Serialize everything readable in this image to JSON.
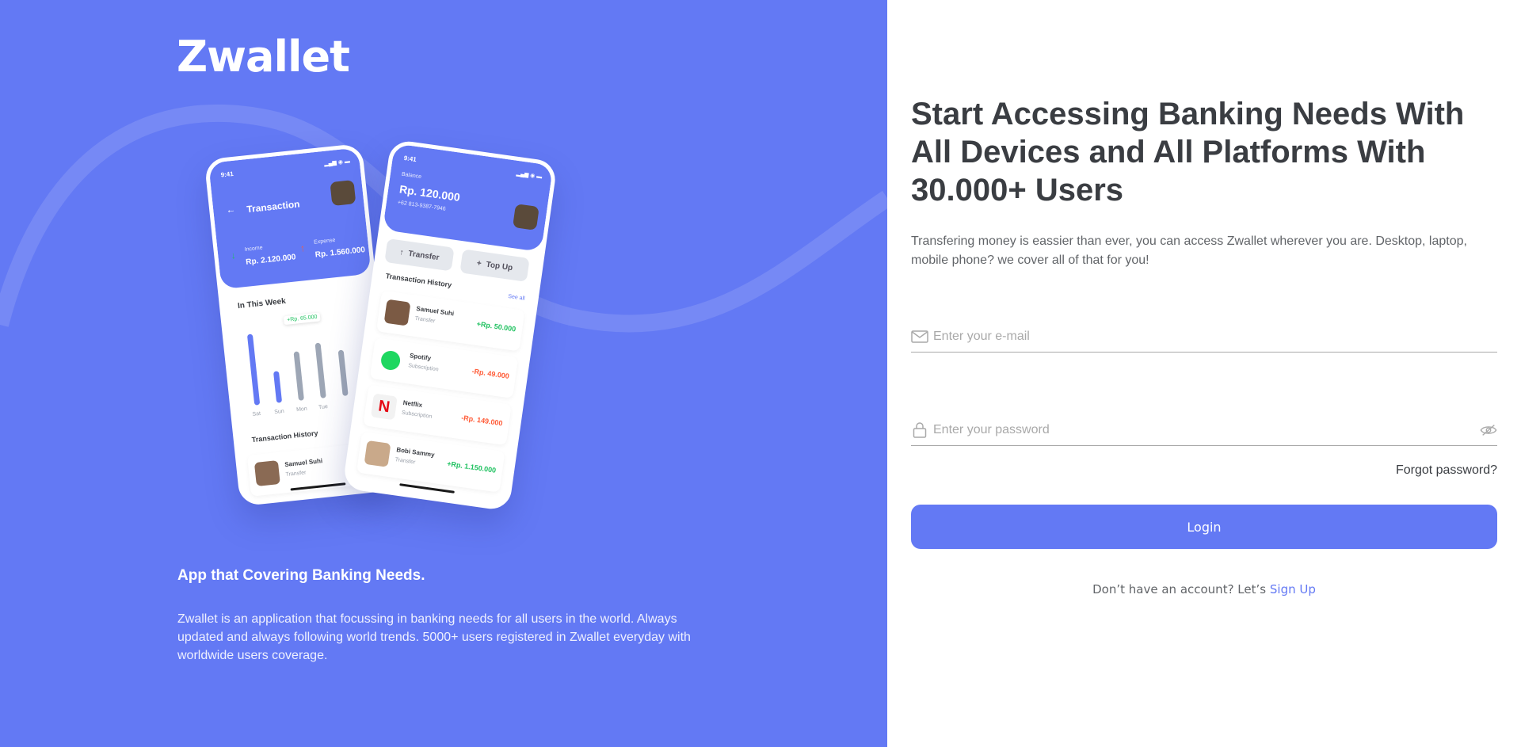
{
  "brand": {
    "logo": "Zwallet",
    "color": "#6379F4"
  },
  "hero": {
    "tagline": "App that Covering Banking Needs.",
    "description": "Zwallet is an application that focussing in banking needs for all users in the world. Always updated and always following world trends. 5000+ users registered in Zwallet everyday with worldwide users coverage."
  },
  "phone_left": {
    "time": "9:41",
    "title": "Transaction",
    "income_label": "Income",
    "income_amount": "Rp. 2.120.000",
    "expense_label": "Expense",
    "expense_amount": "Rp. 1.560.000",
    "week_label": "In This Week",
    "tooltip": "+Rp. 65.000",
    "days": [
      "Sat",
      "Sun",
      "Mon",
      "Tue"
    ],
    "history_label": "Transaction History",
    "history_name": "Samuel Suhi",
    "history_sub": "Transfer"
  },
  "phone_right": {
    "time": "9:41",
    "balance_label": "Balance",
    "balance": "Rp. 120.000",
    "phone": "+62 813-9387-7946",
    "transfer_label": "Transfer",
    "topup_label": "Top Up",
    "history_label": "Transaction History",
    "see_all": "See all",
    "transactions": [
      {
        "name": "Samuel Suhi",
        "type": "Transfer",
        "amount": "+Rp. 50.000"
      },
      {
        "name": "Spotify",
        "type": "Subscription",
        "amount": "-Rp. 49.000"
      },
      {
        "name": "Netflix",
        "type": "Subscription",
        "amount": "-Rp. 149.000"
      },
      {
        "name": "Bobi Sammy",
        "type": "Transfer",
        "amount": "+Rp. 1.150.000"
      }
    ]
  },
  "form": {
    "headline": "Start Accessing Banking Needs With All Devices and All Platforms With 30.000+ Users",
    "subtext": "Transfering money is eassier than ever, you can access Zwallet wherever you are. Desktop, laptop, mobile phone? we cover all of that for you!",
    "email_placeholder": "Enter your e-mail",
    "email_value": "",
    "password_placeholder": "Enter your password",
    "password_value": "",
    "forgot": "Forgot password?",
    "login": "Login",
    "no_account": "Don’t have an account? Let’s",
    "signup": "Sign Up"
  }
}
